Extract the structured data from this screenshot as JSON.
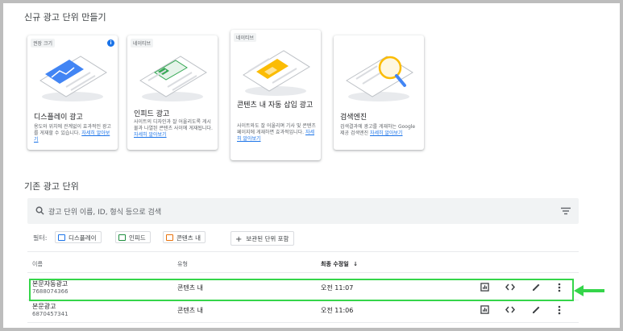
{
  "create_section": {
    "title": "신규 광고 단위 만들기",
    "cards": [
      {
        "badge": "권장 크기",
        "title": "디스플레이 광고",
        "desc": "용도와 위치에 관계없이 효과적인 광고를 게재할 수 있습니다.",
        "link": "자세히 알아보기",
        "has_info": true
      },
      {
        "badge": "네이티브",
        "title": "인피드 광고",
        "desc": "사이트의 디자인과 잘 어울리도록 게시물과 나열된 콘텐츠 사이에 게재됩니다.",
        "link": "자세히 알아보기"
      },
      {
        "badge": "네이티브",
        "title": "콘텐츠 내 자동 삽입 광고",
        "desc": "사이트와도 잘 어울리며 기사 및 콘텐츠 페이지에 게재하면 효과적입니다.",
        "link": "자세히 알아보기"
      },
      {
        "badge": "",
        "title": "검색엔진",
        "desc": "검색결과에 광고를 게재하는 Google 제공 검색엔진",
        "link": "자세히 알아보기"
      }
    ]
  },
  "existing_section": {
    "title": "기존 광고 단위",
    "search_placeholder": "광고 단위 이름, ID, 형식 등으로 검색",
    "filter_label": "필터:",
    "chips": [
      {
        "label": "디스플레이",
        "color": "#1a73e8"
      },
      {
        "label": "인피드",
        "color": "#1e8e3e"
      },
      {
        "label": "콘텐츠 내",
        "color": "#e8710a"
      }
    ],
    "archived_chip": "보관된 단위 포함",
    "columns": {
      "name": "이름",
      "format": "유형",
      "modified": "최종 수정일"
    },
    "rows": [
      {
        "name": "본문자동광고",
        "id": "7688074366",
        "format": "콘텐츠 내",
        "modified": "오전 11:07"
      },
      {
        "name": "본문광고",
        "id": "6870457341",
        "format": "콘텐츠 내",
        "modified": "오전 11:06"
      }
    ]
  },
  "colors": {
    "accent": "#1a73e8",
    "highlight": "#35d54a"
  }
}
